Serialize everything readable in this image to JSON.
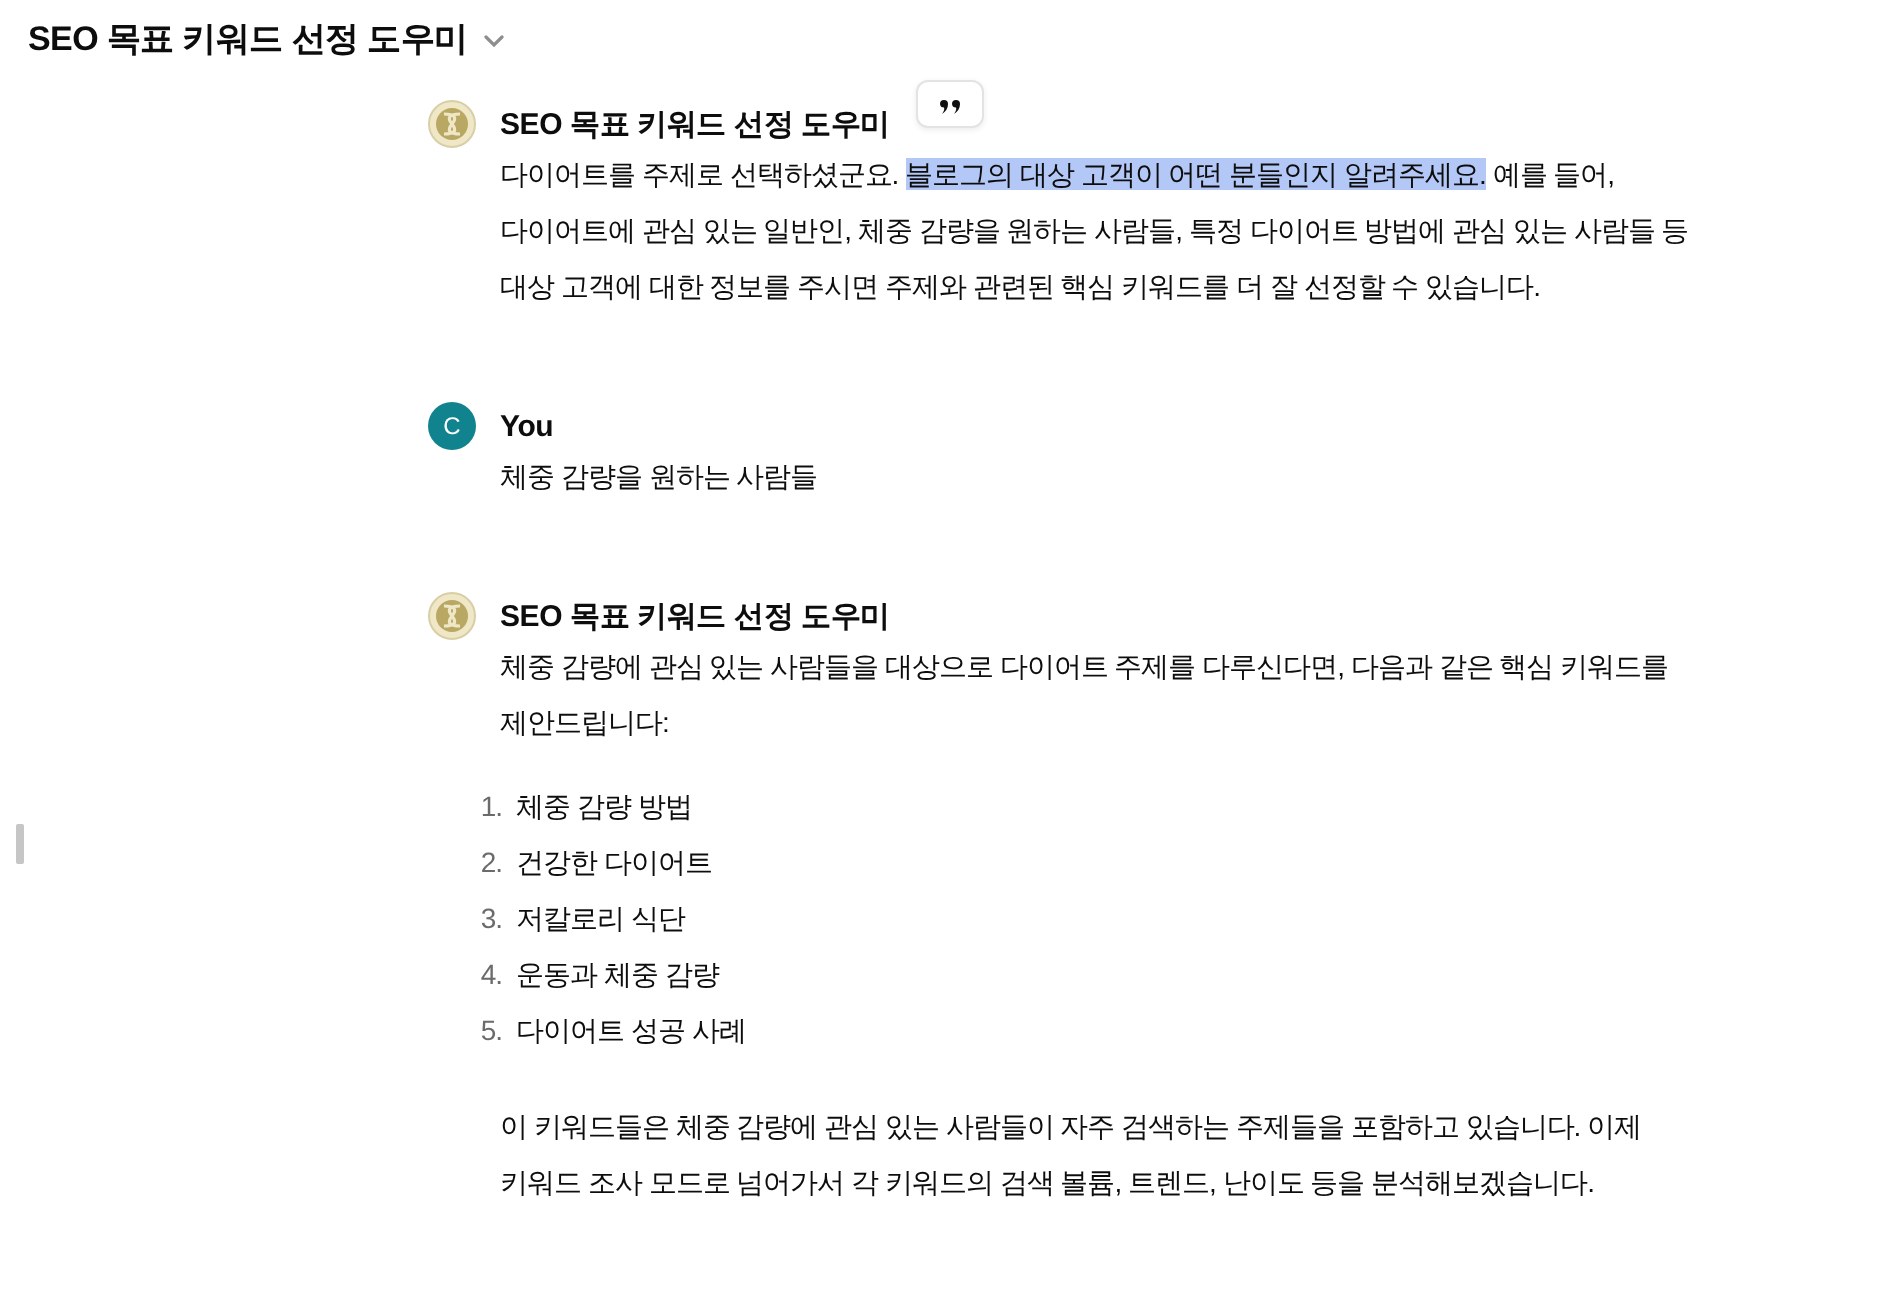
{
  "header": {
    "title": "SEO 목표 키워드 선정 도우미"
  },
  "messages": [
    {
      "kind": "bot",
      "author": "SEO 목표 키워드 선정 도우미",
      "quote_button": true,
      "blocks": [
        {
          "kind": "paragraph",
          "segments": [
            {
              "text": "다이어트를 주제로 선택하셨군요. ",
              "highlighted": false
            },
            {
              "text": "블로그의 대상 고객이 어떤 분들인지 알려주세요.",
              "highlighted": true
            },
            {
              "text": " 예를 들어, 다이어트에 관심 있는 일반인, 체중 감량을 원하는 사람들, 특정 다이어트 방법에 관심 있는 사람들 등 대상 고객에 대한 정보를 주시면 주제와 관련된 핵심 키워드를 더 잘 선정할 수 있습니다.",
              "highlighted": false
            }
          ]
        }
      ]
    },
    {
      "kind": "user",
      "author": "You",
      "avatar_letter": "C",
      "blocks": [
        {
          "kind": "paragraph",
          "segments": [
            {
              "text": "체중 감량을 원하는 사람들",
              "highlighted": false
            }
          ]
        }
      ]
    },
    {
      "kind": "bot",
      "author": "SEO 목표 키워드 선정 도우미",
      "blocks": [
        {
          "kind": "paragraph",
          "segments": [
            {
              "text": "체중 감량에 관심 있는 사람들을 대상으로 다이어트 주제를 다루신다면, 다음과 같은 핵심 키워드를 제안드립니다:",
              "highlighted": false
            }
          ]
        },
        {
          "kind": "list",
          "items": [
            {
              "number": "1.",
              "text": "체중 감량 방법"
            },
            {
              "number": "2.",
              "text": "건강한 다이어트"
            },
            {
              "number": "3.",
              "text": "저칼로리 식단"
            },
            {
              "number": "4.",
              "text": "운동과 체중 감량"
            },
            {
              "number": "5.",
              "text": "다이어트 성공 사례"
            }
          ]
        },
        {
          "kind": "paragraph",
          "segments": [
            {
              "text": "이 키워드들은 체중 감량에 관심 있는 사람들이 자주 검색하는 주제들을 포함하고 있습니다. 이제 키워드 조사 모드로 넘어가서 각 키워드의 검색 볼륨, 트렌드, 난이도 등을 분석해보겠습니다.",
              "highlighted": false
            }
          ]
        }
      ]
    }
  ]
}
